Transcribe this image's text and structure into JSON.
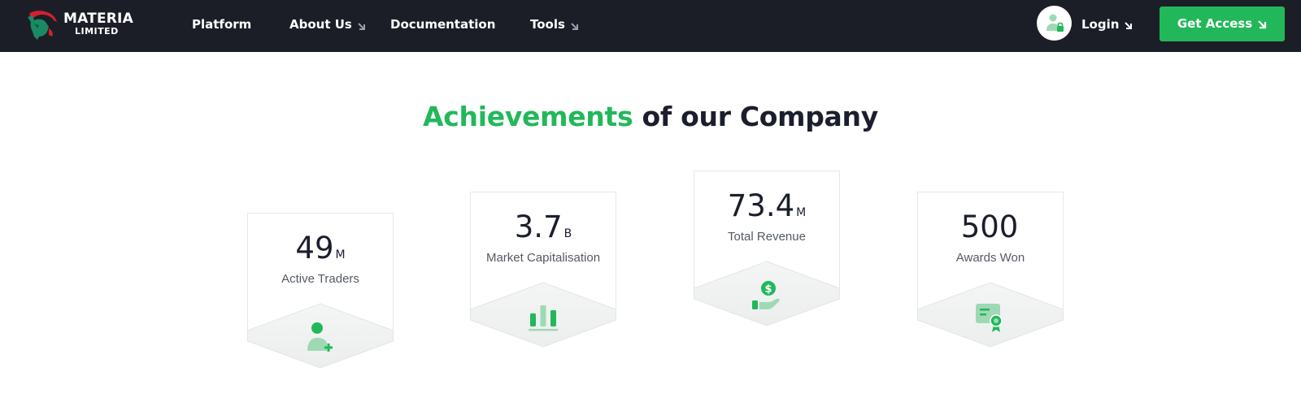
{
  "brand": {
    "name": "MATERIA",
    "sub": "LIMITED",
    "logo_icon": "bull-logo-icon"
  },
  "nav": {
    "items": [
      {
        "label": "Platform",
        "has_arrow": false
      },
      {
        "label": "About Us",
        "has_arrow": true
      },
      {
        "label": "Documentation",
        "has_arrow": false
      },
      {
        "label": "Tools",
        "has_arrow": true
      }
    ],
    "login_label": "Login",
    "cta_label": "Get Access"
  },
  "heading": {
    "accent": "Achievements",
    "rest": "of our Company"
  },
  "stats": [
    {
      "value": "49",
      "unit": "M",
      "label": "Active Traders",
      "icon": "add-user-icon"
    },
    {
      "value": "3.7",
      "unit": "B",
      "label": "Market Capitalisation",
      "icon": "bar-chart-icon"
    },
    {
      "value": "73.4",
      "unit": "M",
      "label": "Total Revenue",
      "icon": "hand-dollar-icon"
    },
    {
      "value": "500",
      "unit": "",
      "label": "Awards Won",
      "icon": "certificate-icon"
    }
  ],
  "colors": {
    "nav_bg": "#1b1e27",
    "accent": "#22b85a",
    "icon_light": "#9fd9b4",
    "text_dark": "#1b1e2c"
  }
}
